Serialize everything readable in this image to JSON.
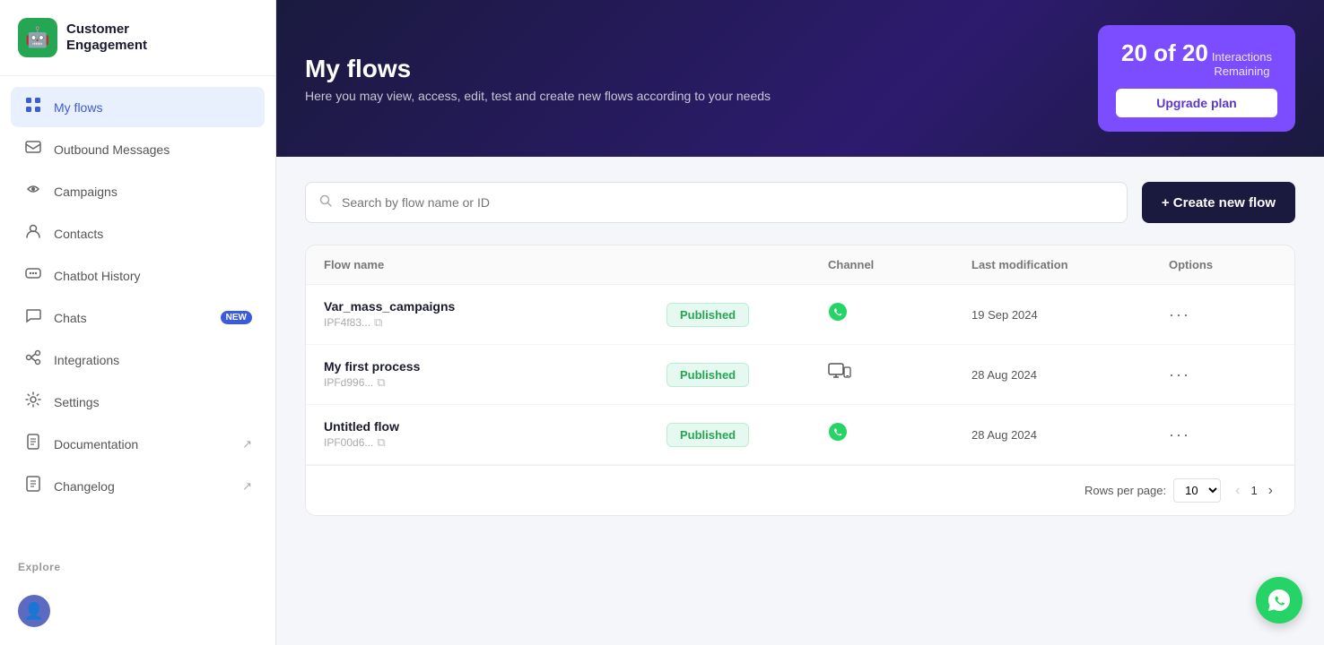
{
  "sidebar": {
    "logo_text": "Customer\nEngagement",
    "nav_items": [
      {
        "id": "my-flows",
        "label": "My flows",
        "icon": "⊞",
        "active": true
      },
      {
        "id": "outbound-messages",
        "label": "Outbound Messages",
        "icon": "💬"
      },
      {
        "id": "campaigns",
        "label": "Campaigns",
        "icon": "📣"
      },
      {
        "id": "contacts",
        "label": "Contacts",
        "icon": "👤"
      },
      {
        "id": "chatbot-history",
        "label": "Chatbot History",
        "icon": "🤖"
      },
      {
        "id": "chats",
        "label": "Chats",
        "icon": "💭",
        "badge": "NEW"
      },
      {
        "id": "integrations",
        "label": "Integrations",
        "icon": "🔗"
      },
      {
        "id": "settings",
        "label": "Settings",
        "icon": "⚙"
      },
      {
        "id": "documentation",
        "label": "Documentation",
        "icon": "📄",
        "ext": true
      },
      {
        "id": "changelog",
        "label": "Changelog",
        "icon": "📋",
        "ext": true
      }
    ],
    "explore_label": "Explore"
  },
  "header": {
    "title": "My flows",
    "subtitle": "Here you may view, access, edit, test and create new flows according to your needs"
  },
  "upgrade_card": {
    "count_label": "20 of 20",
    "remaining_label": "Interactions\nRemaining",
    "button_label": "Upgrade plan"
  },
  "search": {
    "placeholder": "Search by flow name or ID"
  },
  "create_button": {
    "label": "+ Create new flow"
  },
  "table": {
    "columns": [
      "Flow name",
      "Channel",
      "Last modification",
      "Options"
    ],
    "headers": {
      "flow_name": "Flow name",
      "channel": "Channel",
      "last_modification": "Last modification",
      "options": "Options"
    },
    "rows": [
      {
        "name": "Var_mass_campaigns",
        "id": "IPF4f83...",
        "status": "Published",
        "channel": "whatsapp",
        "modification": "19 Sep 2024"
      },
      {
        "name": "My first process",
        "id": "IPFd996...",
        "status": "Published",
        "channel": "desktop-mobile",
        "modification": "28 Aug 2024"
      },
      {
        "name": "Untitled flow",
        "id": "IPF00d6...",
        "status": "Published",
        "channel": "whatsapp",
        "modification": "28 Aug 2024"
      }
    ]
  },
  "pagination": {
    "rows_per_page_label": "Rows per page:",
    "rows_per_page_value": "10",
    "current_page": "1"
  }
}
